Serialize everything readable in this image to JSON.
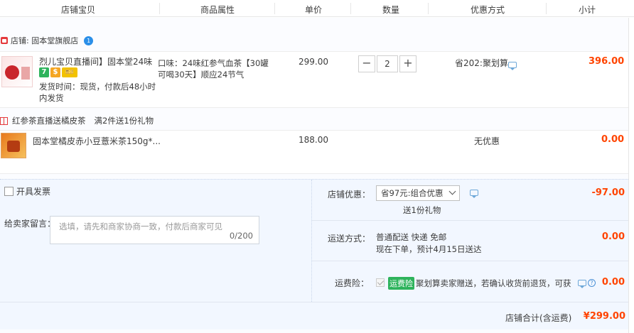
{
  "header": {
    "col_item": "店铺宝贝",
    "col_attr": "商品属性",
    "col_price": "单价",
    "col_qty": "数量",
    "col_discount": "优惠方式",
    "col_subtotal": "小计"
  },
  "shop": {
    "label": "店铺: 固本堂旗舰店"
  },
  "item1": {
    "title": "烈儿宝贝直播间】固本堂24味...",
    "tags": [
      "7",
      "$",
      "🎫"
    ],
    "ship_info": "发货时间：现货，付款后48小时内发货",
    "attr": "口味：24味红参气血茶【30罐 可喝30天】顺应24节气",
    "price": "299.00",
    "qty": "2",
    "minus": "−",
    "plus": "+",
    "discount": "省202:聚划算",
    "subtotal": "396.00"
  },
  "gift": {
    "name": "红参茶直播送橘皮茶",
    "rule": "满2件送1份礼物"
  },
  "item2": {
    "title": "固本堂橘皮赤小豆薏米茶150g*...",
    "price": "188.00",
    "discount": "无优惠",
    "subtotal": "0.00"
  },
  "invoice": {
    "label": "开具发票"
  },
  "memo": {
    "label": "给卖家留言：",
    "placeholder": "选填，请先和商家协商一致，付款后商家可见",
    "count": "0/200"
  },
  "shop_discount": {
    "label": "店铺优惠：",
    "selected": "省97元:组合优惠",
    "note": "送1份礼物",
    "value": "-97.00"
  },
  "shipping": {
    "label": "运送方式：",
    "method": "普通配送 快递 免邮",
    "eta": "现在下单，预计4月15日送达",
    "value": "0.00"
  },
  "insurance": {
    "label": "运费险：",
    "tag": "运费险",
    "text": "聚划算卖家赠送，若确认收货前退货，可获...",
    "value": "0.00"
  },
  "total": {
    "label": "店铺合计(含运费)",
    "value": "¥299.00"
  },
  "colors": {
    "price_red": "#ff4400",
    "accent_blue": "#2b8fe8",
    "bottom_bg": "#f2f7ff"
  }
}
